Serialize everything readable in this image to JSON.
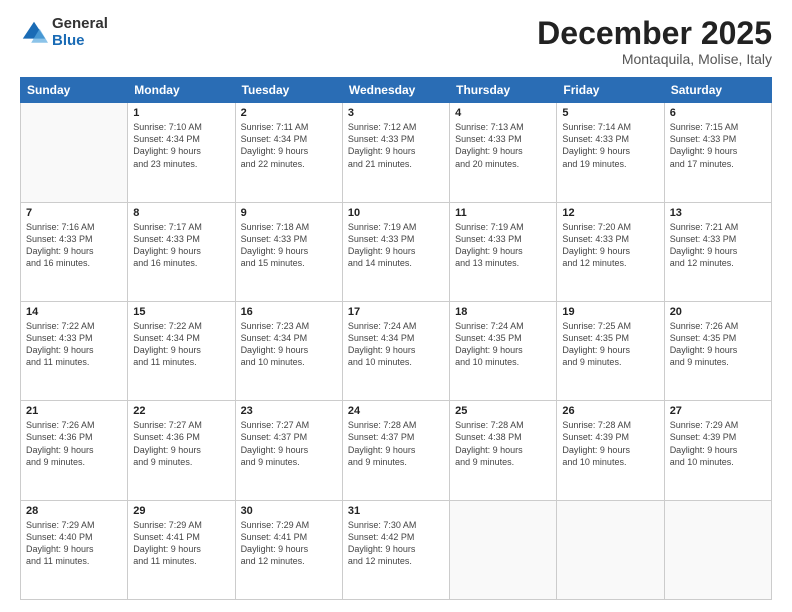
{
  "logo": {
    "general": "General",
    "blue": "Blue"
  },
  "header": {
    "month": "December 2025",
    "location": "Montaquila, Molise, Italy"
  },
  "weekdays": [
    "Sunday",
    "Monday",
    "Tuesday",
    "Wednesday",
    "Thursday",
    "Friday",
    "Saturday"
  ],
  "weeks": [
    [
      {
        "date": "",
        "info": ""
      },
      {
        "date": "1",
        "info": "Sunrise: 7:10 AM\nSunset: 4:34 PM\nDaylight: 9 hours\nand 23 minutes."
      },
      {
        "date": "2",
        "info": "Sunrise: 7:11 AM\nSunset: 4:34 PM\nDaylight: 9 hours\nand 22 minutes."
      },
      {
        "date": "3",
        "info": "Sunrise: 7:12 AM\nSunset: 4:33 PM\nDaylight: 9 hours\nand 21 minutes."
      },
      {
        "date": "4",
        "info": "Sunrise: 7:13 AM\nSunset: 4:33 PM\nDaylight: 9 hours\nand 20 minutes."
      },
      {
        "date": "5",
        "info": "Sunrise: 7:14 AM\nSunset: 4:33 PM\nDaylight: 9 hours\nand 19 minutes."
      },
      {
        "date": "6",
        "info": "Sunrise: 7:15 AM\nSunset: 4:33 PM\nDaylight: 9 hours\nand 17 minutes."
      }
    ],
    [
      {
        "date": "7",
        "info": "Sunrise: 7:16 AM\nSunset: 4:33 PM\nDaylight: 9 hours\nand 16 minutes."
      },
      {
        "date": "8",
        "info": "Sunrise: 7:17 AM\nSunset: 4:33 PM\nDaylight: 9 hours\nand 16 minutes."
      },
      {
        "date": "9",
        "info": "Sunrise: 7:18 AM\nSunset: 4:33 PM\nDaylight: 9 hours\nand 15 minutes."
      },
      {
        "date": "10",
        "info": "Sunrise: 7:19 AM\nSunset: 4:33 PM\nDaylight: 9 hours\nand 14 minutes."
      },
      {
        "date": "11",
        "info": "Sunrise: 7:19 AM\nSunset: 4:33 PM\nDaylight: 9 hours\nand 13 minutes."
      },
      {
        "date": "12",
        "info": "Sunrise: 7:20 AM\nSunset: 4:33 PM\nDaylight: 9 hours\nand 12 minutes."
      },
      {
        "date": "13",
        "info": "Sunrise: 7:21 AM\nSunset: 4:33 PM\nDaylight: 9 hours\nand 12 minutes."
      }
    ],
    [
      {
        "date": "14",
        "info": "Sunrise: 7:22 AM\nSunset: 4:33 PM\nDaylight: 9 hours\nand 11 minutes."
      },
      {
        "date": "15",
        "info": "Sunrise: 7:22 AM\nSunset: 4:34 PM\nDaylight: 9 hours\nand 11 minutes."
      },
      {
        "date": "16",
        "info": "Sunrise: 7:23 AM\nSunset: 4:34 PM\nDaylight: 9 hours\nand 10 minutes."
      },
      {
        "date": "17",
        "info": "Sunrise: 7:24 AM\nSunset: 4:34 PM\nDaylight: 9 hours\nand 10 minutes."
      },
      {
        "date": "18",
        "info": "Sunrise: 7:24 AM\nSunset: 4:35 PM\nDaylight: 9 hours\nand 10 minutes."
      },
      {
        "date": "19",
        "info": "Sunrise: 7:25 AM\nSunset: 4:35 PM\nDaylight: 9 hours\nand 9 minutes."
      },
      {
        "date": "20",
        "info": "Sunrise: 7:26 AM\nSunset: 4:35 PM\nDaylight: 9 hours\nand 9 minutes."
      }
    ],
    [
      {
        "date": "21",
        "info": "Sunrise: 7:26 AM\nSunset: 4:36 PM\nDaylight: 9 hours\nand 9 minutes."
      },
      {
        "date": "22",
        "info": "Sunrise: 7:27 AM\nSunset: 4:36 PM\nDaylight: 9 hours\nand 9 minutes."
      },
      {
        "date": "23",
        "info": "Sunrise: 7:27 AM\nSunset: 4:37 PM\nDaylight: 9 hours\nand 9 minutes."
      },
      {
        "date": "24",
        "info": "Sunrise: 7:28 AM\nSunset: 4:37 PM\nDaylight: 9 hours\nand 9 minutes."
      },
      {
        "date": "25",
        "info": "Sunrise: 7:28 AM\nSunset: 4:38 PM\nDaylight: 9 hours\nand 9 minutes."
      },
      {
        "date": "26",
        "info": "Sunrise: 7:28 AM\nSunset: 4:39 PM\nDaylight: 9 hours\nand 10 minutes."
      },
      {
        "date": "27",
        "info": "Sunrise: 7:29 AM\nSunset: 4:39 PM\nDaylight: 9 hours\nand 10 minutes."
      }
    ],
    [
      {
        "date": "28",
        "info": "Sunrise: 7:29 AM\nSunset: 4:40 PM\nDaylight: 9 hours\nand 11 minutes."
      },
      {
        "date": "29",
        "info": "Sunrise: 7:29 AM\nSunset: 4:41 PM\nDaylight: 9 hours\nand 11 minutes."
      },
      {
        "date": "30",
        "info": "Sunrise: 7:29 AM\nSunset: 4:41 PM\nDaylight: 9 hours\nand 12 minutes."
      },
      {
        "date": "31",
        "info": "Sunrise: 7:30 AM\nSunset: 4:42 PM\nDaylight: 9 hours\nand 12 minutes."
      },
      {
        "date": "",
        "info": ""
      },
      {
        "date": "",
        "info": ""
      },
      {
        "date": "",
        "info": ""
      }
    ]
  ]
}
